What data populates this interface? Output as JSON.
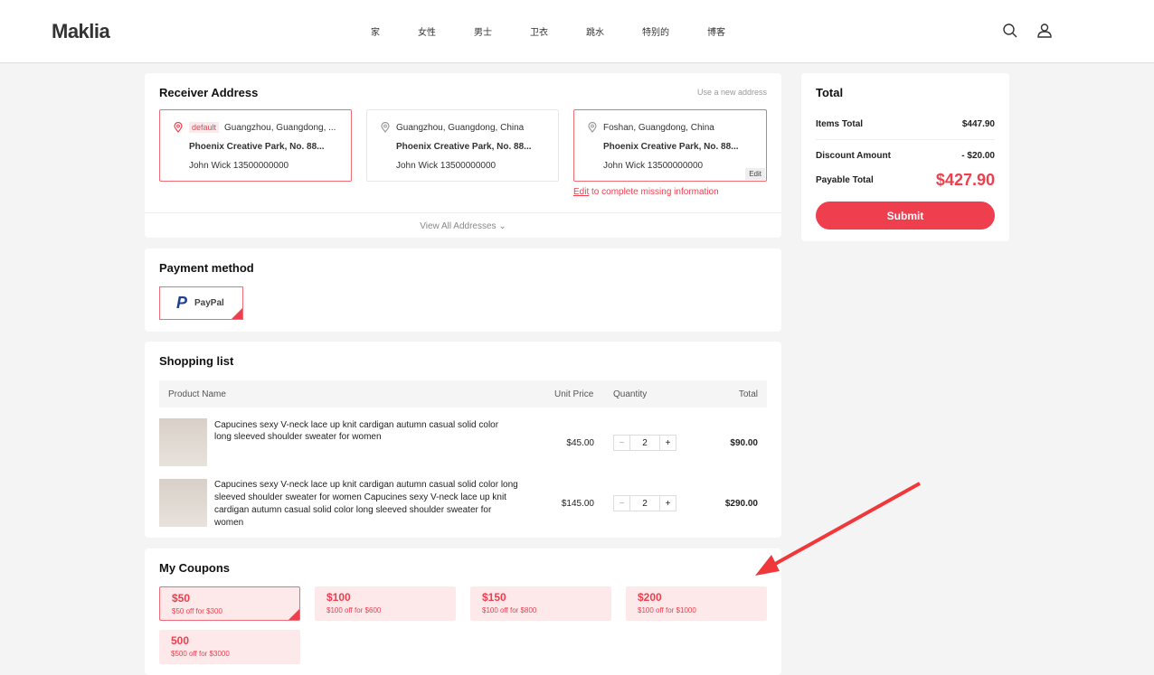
{
  "header": {
    "logo": "Maklia",
    "nav": [
      "家",
      "女性",
      "男士",
      "卫衣",
      "跳水",
      "特别的",
      "博客"
    ]
  },
  "address": {
    "title": "Receiver Address",
    "new_link": "Use a new address",
    "default_tag": "default",
    "cards": [
      {
        "city": "Guangzhou, Guangdong, ...",
        "street": "Phoenix Creative Park, No. 88...",
        "contact": "John Wick  13500000000"
      },
      {
        "city": "Guangzhou, Guangdong, China",
        "street": "Phoenix Creative Park, No. 88...",
        "contact": "John Wick  13500000000"
      },
      {
        "city": "Foshan, Guangdong, China",
        "street": "Phoenix Creative Park, No. 88...",
        "contact": "John Wick  13500000000",
        "edit": "Edit"
      }
    ],
    "edit_link": "Edit",
    "missing_msg": " to complete missing information",
    "view_all": "View All Addresses"
  },
  "payment": {
    "title": "Payment method",
    "option": "PayPal"
  },
  "shopping": {
    "title": "Shopping list",
    "headers": [
      "Product Name",
      "Unit Price",
      "Quantity",
      "Total"
    ],
    "items": [
      {
        "name": "Capucines sexy V-neck lace up knit cardigan autumn casual solid color long sleeved shoulder sweater for women",
        "price": "$45.00",
        "qty": "2",
        "total": "$90.00"
      },
      {
        "name": "Capucines sexy V-neck lace up knit cardigan autumn casual solid color long sleeved shoulder sweater for women Capucines sexy V-neck lace up knit cardigan autumn casual solid color long sleeved shoulder sweater for women",
        "price": "$145.00",
        "qty": "2",
        "total": "$290.00"
      }
    ]
  },
  "coupons": {
    "title": "My Coupons",
    "items": [
      {
        "amount": "$50",
        "desc": "$50 off for $300"
      },
      {
        "amount": "$100",
        "desc": "$100 off for $600"
      },
      {
        "amount": "$150",
        "desc": "$100 off for $800"
      },
      {
        "amount": "$200",
        "desc": "$100 off for $1000"
      },
      {
        "amount": "500",
        "desc": "$500 off for $3000"
      }
    ]
  },
  "total": {
    "title": "Total",
    "items_label": "Items Total",
    "items_value": "$447.90",
    "discount_label": "Discount Amount",
    "discount_value": "- $20.00",
    "payable_label": "Payable Total",
    "payable_value": "$427.90",
    "submit": "Submit"
  }
}
